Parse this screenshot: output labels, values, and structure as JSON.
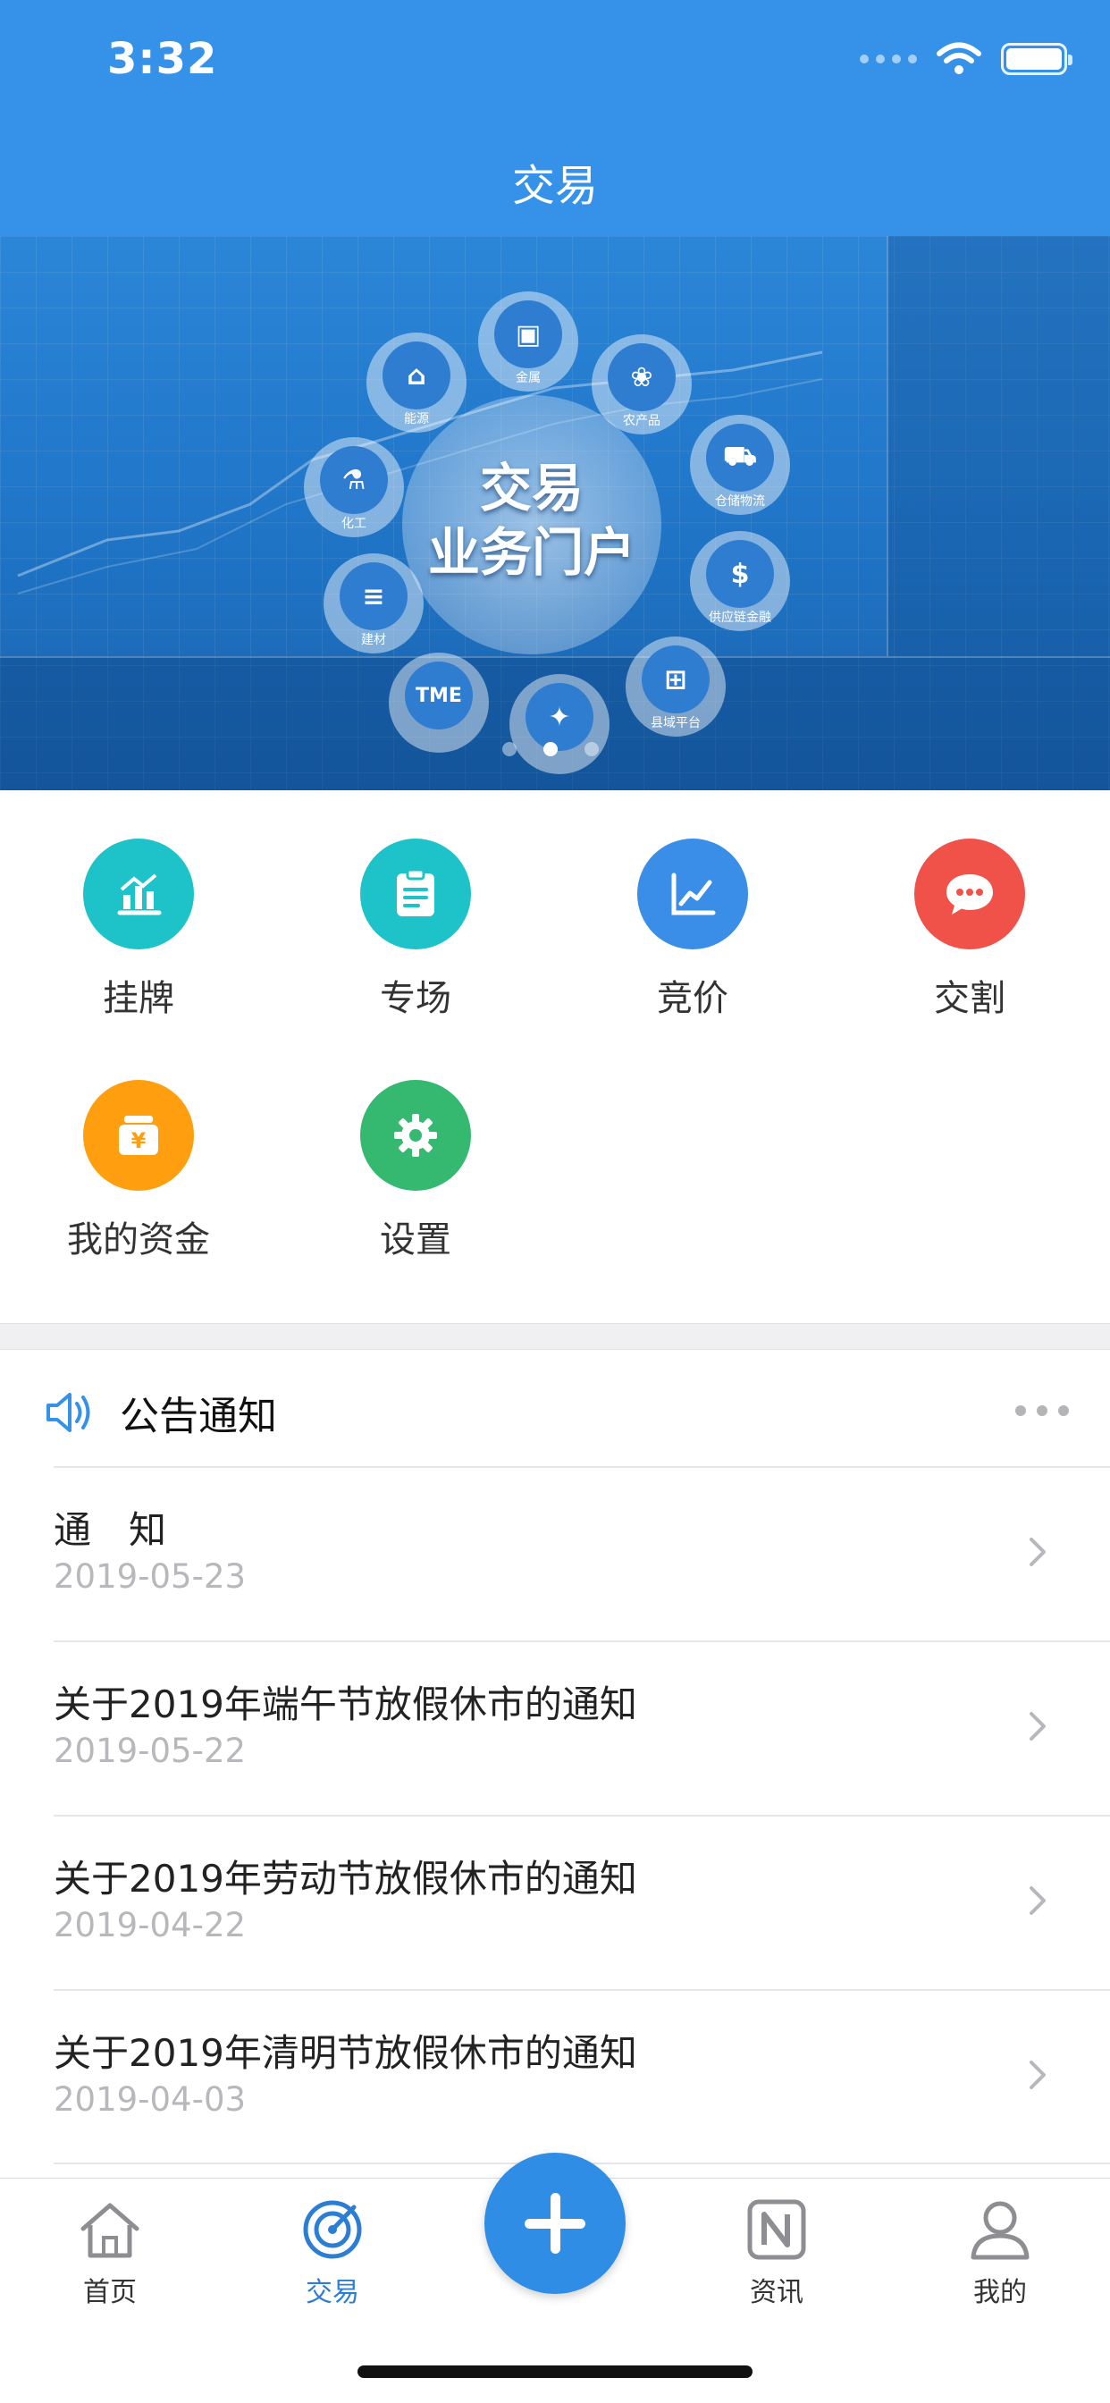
{
  "status_bar": {
    "time": "3:32"
  },
  "nav": {
    "title": "交易"
  },
  "banner": {
    "hub_title_line1": "交易",
    "hub_title_line2": "业务门户",
    "nodes": [
      "金属",
      "能源",
      "农产品",
      "化工",
      "仓储物流",
      "建材",
      "供应链金融",
      "TME",
      "县域平台"
    ],
    "page_count": 3,
    "active_page": 1
  },
  "grid": {
    "items": [
      {
        "label": "挂牌",
        "icon": "chart-icon",
        "color": "#1dc3c9"
      },
      {
        "label": "专场",
        "icon": "clipboard-icon",
        "color": "#1dc3c9"
      },
      {
        "label": "竞价",
        "icon": "line-chart-icon",
        "color": "#3a8ee8"
      },
      {
        "label": "交割",
        "icon": "chat-icon",
        "color": "#f0524a"
      },
      {
        "label": "我的资金",
        "icon": "wallet-icon",
        "color": "#ff9f0f"
      },
      {
        "label": "设置",
        "icon": "gear-icon",
        "color": "#35b870"
      }
    ]
  },
  "notices": {
    "title": "公告通知",
    "items": [
      {
        "title": "通　知",
        "date": "2019-05-23"
      },
      {
        "title": "关于2019年端午节放假休市的通知",
        "date": "2019-05-22"
      },
      {
        "title": "关于2019年劳动节放假休市的通知",
        "date": "2019-04-22"
      },
      {
        "title": "关于2019年清明节放假休市的通知",
        "date": "2019-04-03"
      }
    ]
  },
  "tabbar": {
    "tabs": [
      {
        "label": "首页",
        "icon": "home-icon"
      },
      {
        "label": "交易",
        "icon": "trade-icon",
        "active": true
      },
      {
        "label": "资讯",
        "icon": "news-icon"
      },
      {
        "label": "我的",
        "icon": "profile-icon"
      }
    ],
    "center_action_icon": "plus-icon"
  },
  "colors": {
    "primary": "#3592e8",
    "active_tab": "#2b7ed4",
    "muted": "#b8b8bc"
  }
}
